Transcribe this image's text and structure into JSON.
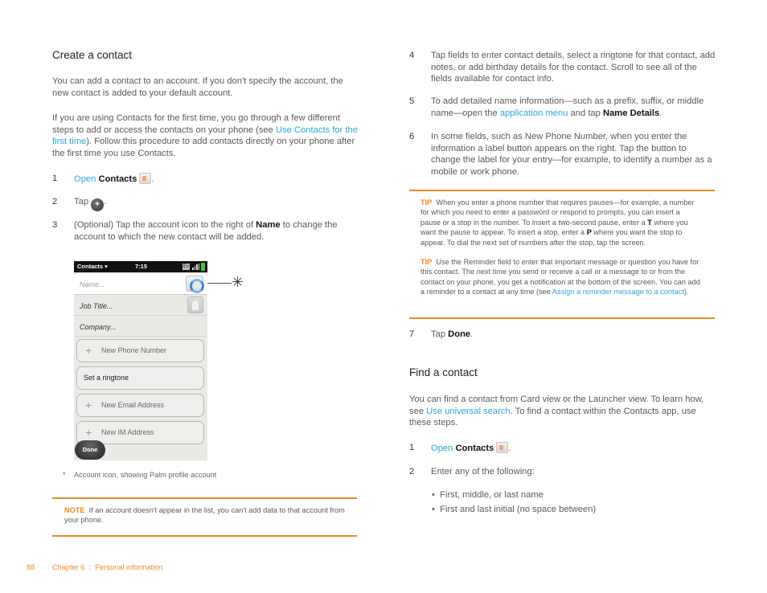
{
  "left": {
    "heading": "Create a contact",
    "intro": "You can add a contact to an account. If you don't specify the account, the new contact is added to your default account.",
    "para2_before": "If you are using Contacts for the first time, you go through a few different steps to add or access the contacts on your phone (see ",
    "para2_link": "Use Contacts for the first time",
    "para2_after": "). Follow this procedure to add contacts directly on your phone after the first time you use Contacts.",
    "steps": [
      {
        "num": "1",
        "link": "Open",
        "bold": "Contacts",
        "icon": "contacts-app-icon",
        "after": "."
      },
      {
        "num": "2",
        "text": "Tap",
        "icon": "add-contact-icon",
        "after": "."
      },
      {
        "num": "3",
        "before": "(Optional) Tap the account icon to the right of ",
        "bold": "Name",
        "after": " to change the account to which the new contact will be added."
      }
    ],
    "phone": {
      "app_menu": "Contacts ▾",
      "time": "7:15",
      "network": "Ev",
      "fields": {
        "name_placeholder": "Name...",
        "job_title": "Job Title...",
        "company": "Company..."
      },
      "buttons": {
        "new_phone": "New Phone Number",
        "ringtone": "Set a ringtone",
        "new_email": "New Email Address",
        "new_im": "New IM Address",
        "done": "Done",
        "plus": "+"
      },
      "callout_marker": "✳"
    },
    "footnote_marker": "*",
    "footnote": "Account icon, showing Palm profile account",
    "note_label": "NOTE",
    "note_text": "If an account doesn't appear in the list, you can't add data to that account from your phone."
  },
  "right": {
    "steps_top": [
      {
        "num": "4",
        "text": "Tap fields to enter contact details, select a ringtone for that contact, add notes, or add birthday details for the contact. Scroll to see all of the fields available for contact info."
      },
      {
        "num": "5",
        "before": "To add detailed name information—such as a prefix, suffix, or middle name—open the ",
        "link": "application menu",
        "middle": " and tap ",
        "bold": "Name Details",
        "after": "."
      },
      {
        "num": "6",
        "text": "In some fields, such as New Phone Number, when you enter the information a label button appears on the right. Tap the button to change the label for your entry—for example, to identify a number as a mobile or work phone."
      }
    ],
    "tip1": {
      "label": "TIP",
      "text1": "When you enter a phone number that requires pauses—for example, a number for which you need to enter a password or respond to prompts, you can insert a pause or a stop in the number. To insert a two-second pause, enter a ",
      "bold1": "T",
      "text2": " where you want the pause to appear. To insert a stop, enter a ",
      "bold2": "P",
      "text3": " where you want the stop to appear. To dial the next set of numbers after the stop, tap the screen."
    },
    "tip2": {
      "label": "TIP",
      "text": "Use the Reminder field to enter that important message or question you have for this contact. The next time you send or receive a call or a message to or from the contact on your phone, you get a notification at the bottom of the screen. You can add a reminder to a contact at any time (see ",
      "link": "Assign a reminder message to a contact",
      "after": ")."
    },
    "step7": {
      "num": "7",
      "text": "Tap ",
      "bold": "Done",
      "after": "."
    },
    "find": {
      "heading": "Find a contact",
      "intro_before": "You can find a contact from Card view or the Launcher view. To learn how, see ",
      "intro_link": "Use universal search",
      "intro_after": ". To find a contact within the Contacts app, use these steps.",
      "step1": {
        "num": "1",
        "link": "Open",
        "bold": "Contacts",
        "after": "."
      },
      "step2": {
        "num": "2",
        "text": "Enter any of the following:"
      },
      "bullets": [
        "First, middle, or last name",
        "First and last initial (no space between)"
      ],
      "bullet_char": "•"
    }
  },
  "footer": {
    "page_number": "88",
    "chapter": "Chapter 6  :  Personal information"
  },
  "colors": {
    "accent_orange": "#ee8a1e",
    "link_blue": "#2aa8d8"
  }
}
